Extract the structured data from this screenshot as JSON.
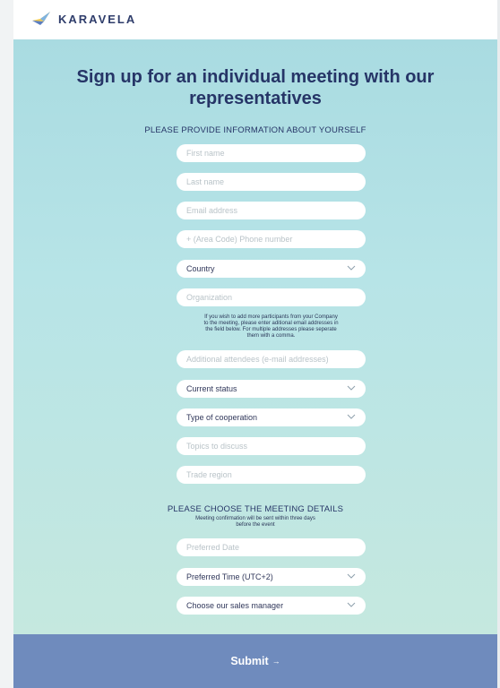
{
  "header": {
    "brand": "KARAVELA",
    "logo_icon": "bird-logo-icon"
  },
  "page": {
    "title_line1": "Sign up for an individual meeting with our",
    "title_line2": "representatives",
    "section1_heading": "PLEASE PROVIDE INFORMATION ABOUT YOURSELF",
    "section2_heading": "PLEASE CHOOSE THE MEETING DETAILS",
    "section2_note_line1": "Meeting confirmation will be sent within three days",
    "section2_note_line2": "before the event",
    "attendees_note_line1": "If you wish to add more participants from your Company",
    "attendees_note_line2": "to the meeting, please enter aditional email addresses in",
    "attendees_note_line3": "the field below. For multiple addresses please seperate",
    "attendees_note_line4": "them with a comma."
  },
  "form": {
    "first_name": "First name",
    "last_name": "Last name",
    "email": "Email address",
    "phone": "+ (Area Code) Phone number",
    "country": "Country",
    "organization": "Organization",
    "attendees": "Additional attendees (e-mail addresses)",
    "current_status": "Current status",
    "cooperation_type": "Type of cooperation",
    "topics": "Topics to discuss",
    "trade_region": "Trade region",
    "preferred_date": "Preferred Date",
    "preferred_time": "Preferred Time (UTC+2)",
    "sales_manager": "Choose our sales manager"
  },
  "footer": {
    "submit_label": "Submit",
    "submit_arrow": "→"
  },
  "colors": {
    "title": "#263567",
    "submit_bg": "#6f8bbd",
    "bg_top": "#a9dbe1",
    "bg_bottom": "#c5e8df"
  }
}
